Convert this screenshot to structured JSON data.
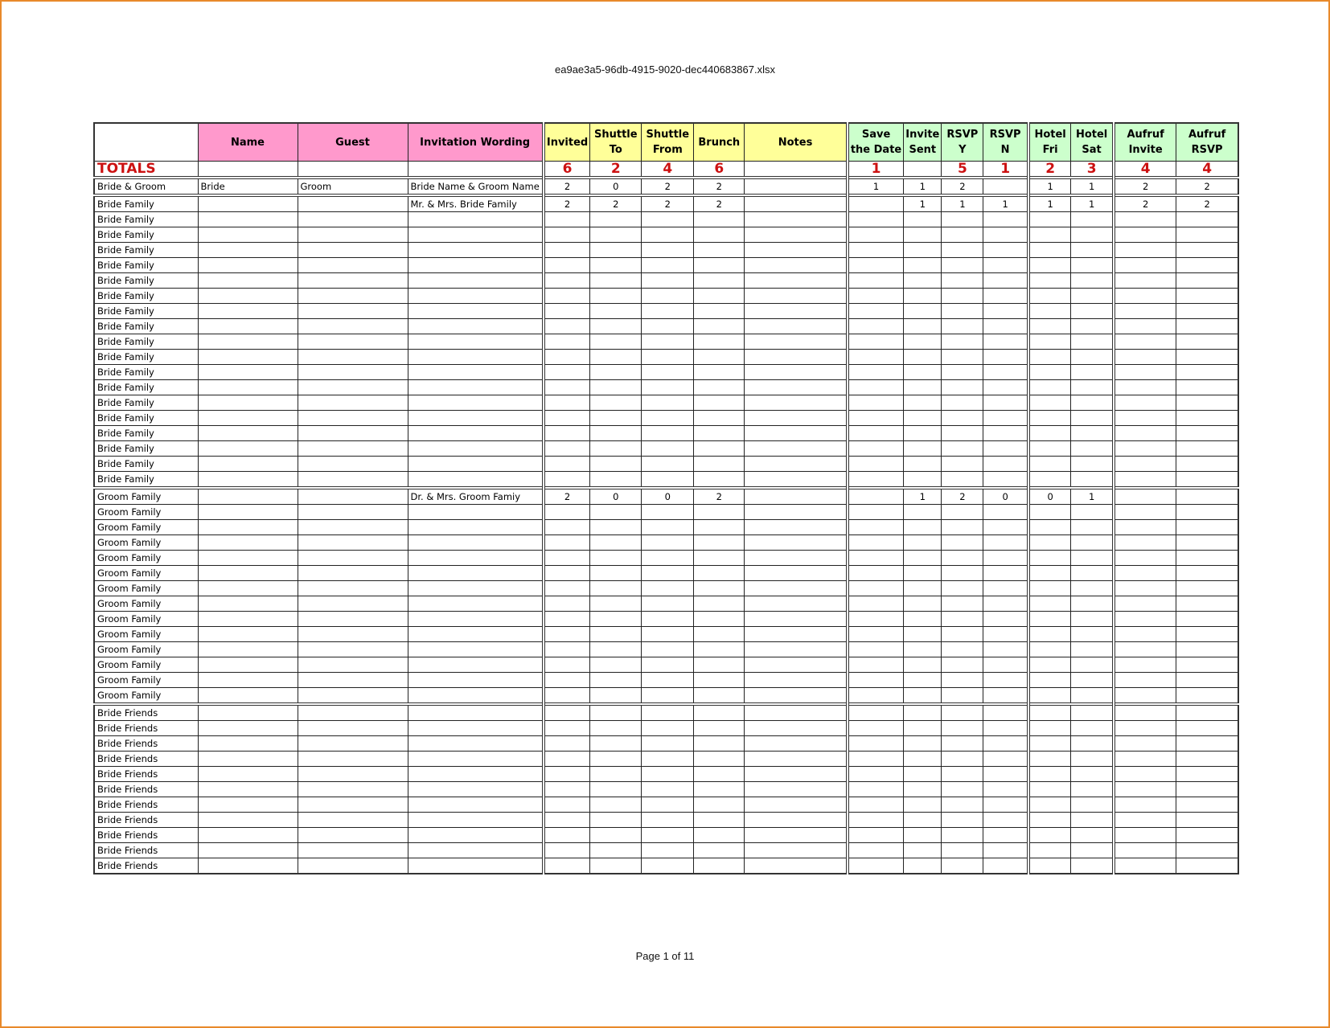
{
  "document": {
    "title": "ea9ae3a5-96db-4915-9020-dec440683867.xlsx",
    "footer": "Page 1 of 11"
  },
  "colors": {
    "frame_border": "#E8892B",
    "header_pink": "#FF99CC",
    "header_yellow": "#FFFF99",
    "header_green": "#CCFFCC",
    "totals_red": "#CC1111"
  },
  "columns": [
    {
      "key": "group",
      "label": "",
      "fill": "none"
    },
    {
      "key": "name",
      "label": "Name",
      "fill": "pink"
    },
    {
      "key": "guest",
      "label": "Guest",
      "fill": "pink"
    },
    {
      "key": "wording",
      "label": "Invitation Wording",
      "fill": "pink"
    },
    {
      "key": "invited",
      "label": "Invited",
      "fill": "yellow"
    },
    {
      "key": "shuttle_to",
      "label": "Shuttle To",
      "fill": "yellow"
    },
    {
      "key": "shuttle_from",
      "label": "Shuttle From",
      "fill": "yellow"
    },
    {
      "key": "brunch",
      "label": "Brunch",
      "fill": "yellow"
    },
    {
      "key": "notes",
      "label": "Notes",
      "fill": "yellow"
    },
    {
      "key": "save_the_date",
      "label": "Save the Date",
      "fill": "green"
    },
    {
      "key": "invite_sent",
      "label": "Invite Sent",
      "fill": "green"
    },
    {
      "key": "rsvp_y",
      "label": "RSVP Y",
      "fill": "green"
    },
    {
      "key": "rsvp_n",
      "label": "RSVP N",
      "fill": "green"
    },
    {
      "key": "hotel_fri",
      "label": "Hotel Fri",
      "fill": "green"
    },
    {
      "key": "hotel_sat",
      "label": "Hotel Sat",
      "fill": "green"
    },
    {
      "key": "aufruf_invite",
      "label": "Aufruf Invite",
      "fill": "green"
    },
    {
      "key": "aufruf_rsvp",
      "label": "Aufruf RSVP",
      "fill": "green"
    }
  ],
  "totals": {
    "label": "TOTALS",
    "values": [
      "",
      "",
      "",
      "6",
      "2",
      "4",
      "6",
      "",
      "1",
      "",
      "5",
      "1",
      "2",
      "3",
      "4",
      "4"
    ]
  },
  "groups": [
    {
      "name": "Bride & Groom",
      "tall": true,
      "rows": [
        [
          "Bride & Groom",
          "Bride",
          "Groom",
          "Bride Name & Groom Name",
          "2",
          "0",
          "2",
          "2",
          "",
          "1",
          "1",
          "2",
          "",
          "1",
          "1",
          "2",
          "2"
        ]
      ]
    },
    {
      "name": "Bride Family",
      "first_row": [
        "Bride Family",
        "",
        "",
        "Mr. & Mrs. Bride Family",
        "2",
        "2",
        "2",
        "2",
        "",
        "",
        "1",
        "1",
        "1",
        "1",
        "1",
        "2",
        "2"
      ],
      "blank_label": "Bride Family",
      "blank_count": 18
    },
    {
      "name": "Groom Family",
      "first_row": [
        "Groom Family",
        "",
        "",
        "Dr. & Mrs. Groom Famiy",
        "2",
        "0",
        "0",
        "2",
        "",
        "",
        "1",
        "2",
        "0",
        "0",
        "1",
        "",
        ""
      ],
      "blank_label": "Groom Family",
      "blank_count": 13
    },
    {
      "name": "Bride Friends",
      "first_row": [
        "Bride Friends",
        "",
        "",
        "",
        "",
        "",
        "",
        "",
        "",
        "",
        "",
        "",
        "",
        "",
        "",
        "",
        ""
      ],
      "blank_label": "Bride Friends",
      "blank_count": 10
    }
  ]
}
